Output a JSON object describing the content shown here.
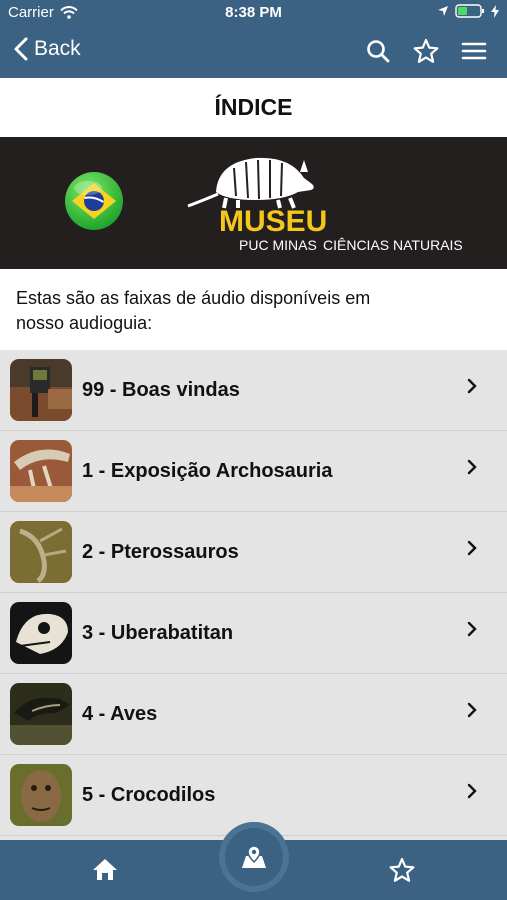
{
  "status_bar": {
    "carrier": "Carrier",
    "time": "8:38 PM"
  },
  "nav": {
    "back_label": "Back"
  },
  "page": {
    "title": "ÍNDICE"
  },
  "banner": {
    "logo_main": "MUSEU",
    "logo_sub1": "PUC MINAS",
    "logo_sub2": "CIÊNCIAS NATURAIS"
  },
  "intro": {
    "text": "Estas são as faixas de áudio disponíveis em nosso audioguia:"
  },
  "tracks": [
    {
      "label": "99 - Boas vindas"
    },
    {
      "label": "1 - Exposição Archosauria"
    },
    {
      "label": "2 - Pterossauros"
    },
    {
      "label": "3 - Uberabatitan"
    },
    {
      "label": "4 - Aves"
    },
    {
      "label": "5 - Crocodilos"
    }
  ],
  "colors": {
    "bar": "#3b6183",
    "list_bg": "#e3e4e3",
    "logo_yellow": "#f3c81a"
  }
}
